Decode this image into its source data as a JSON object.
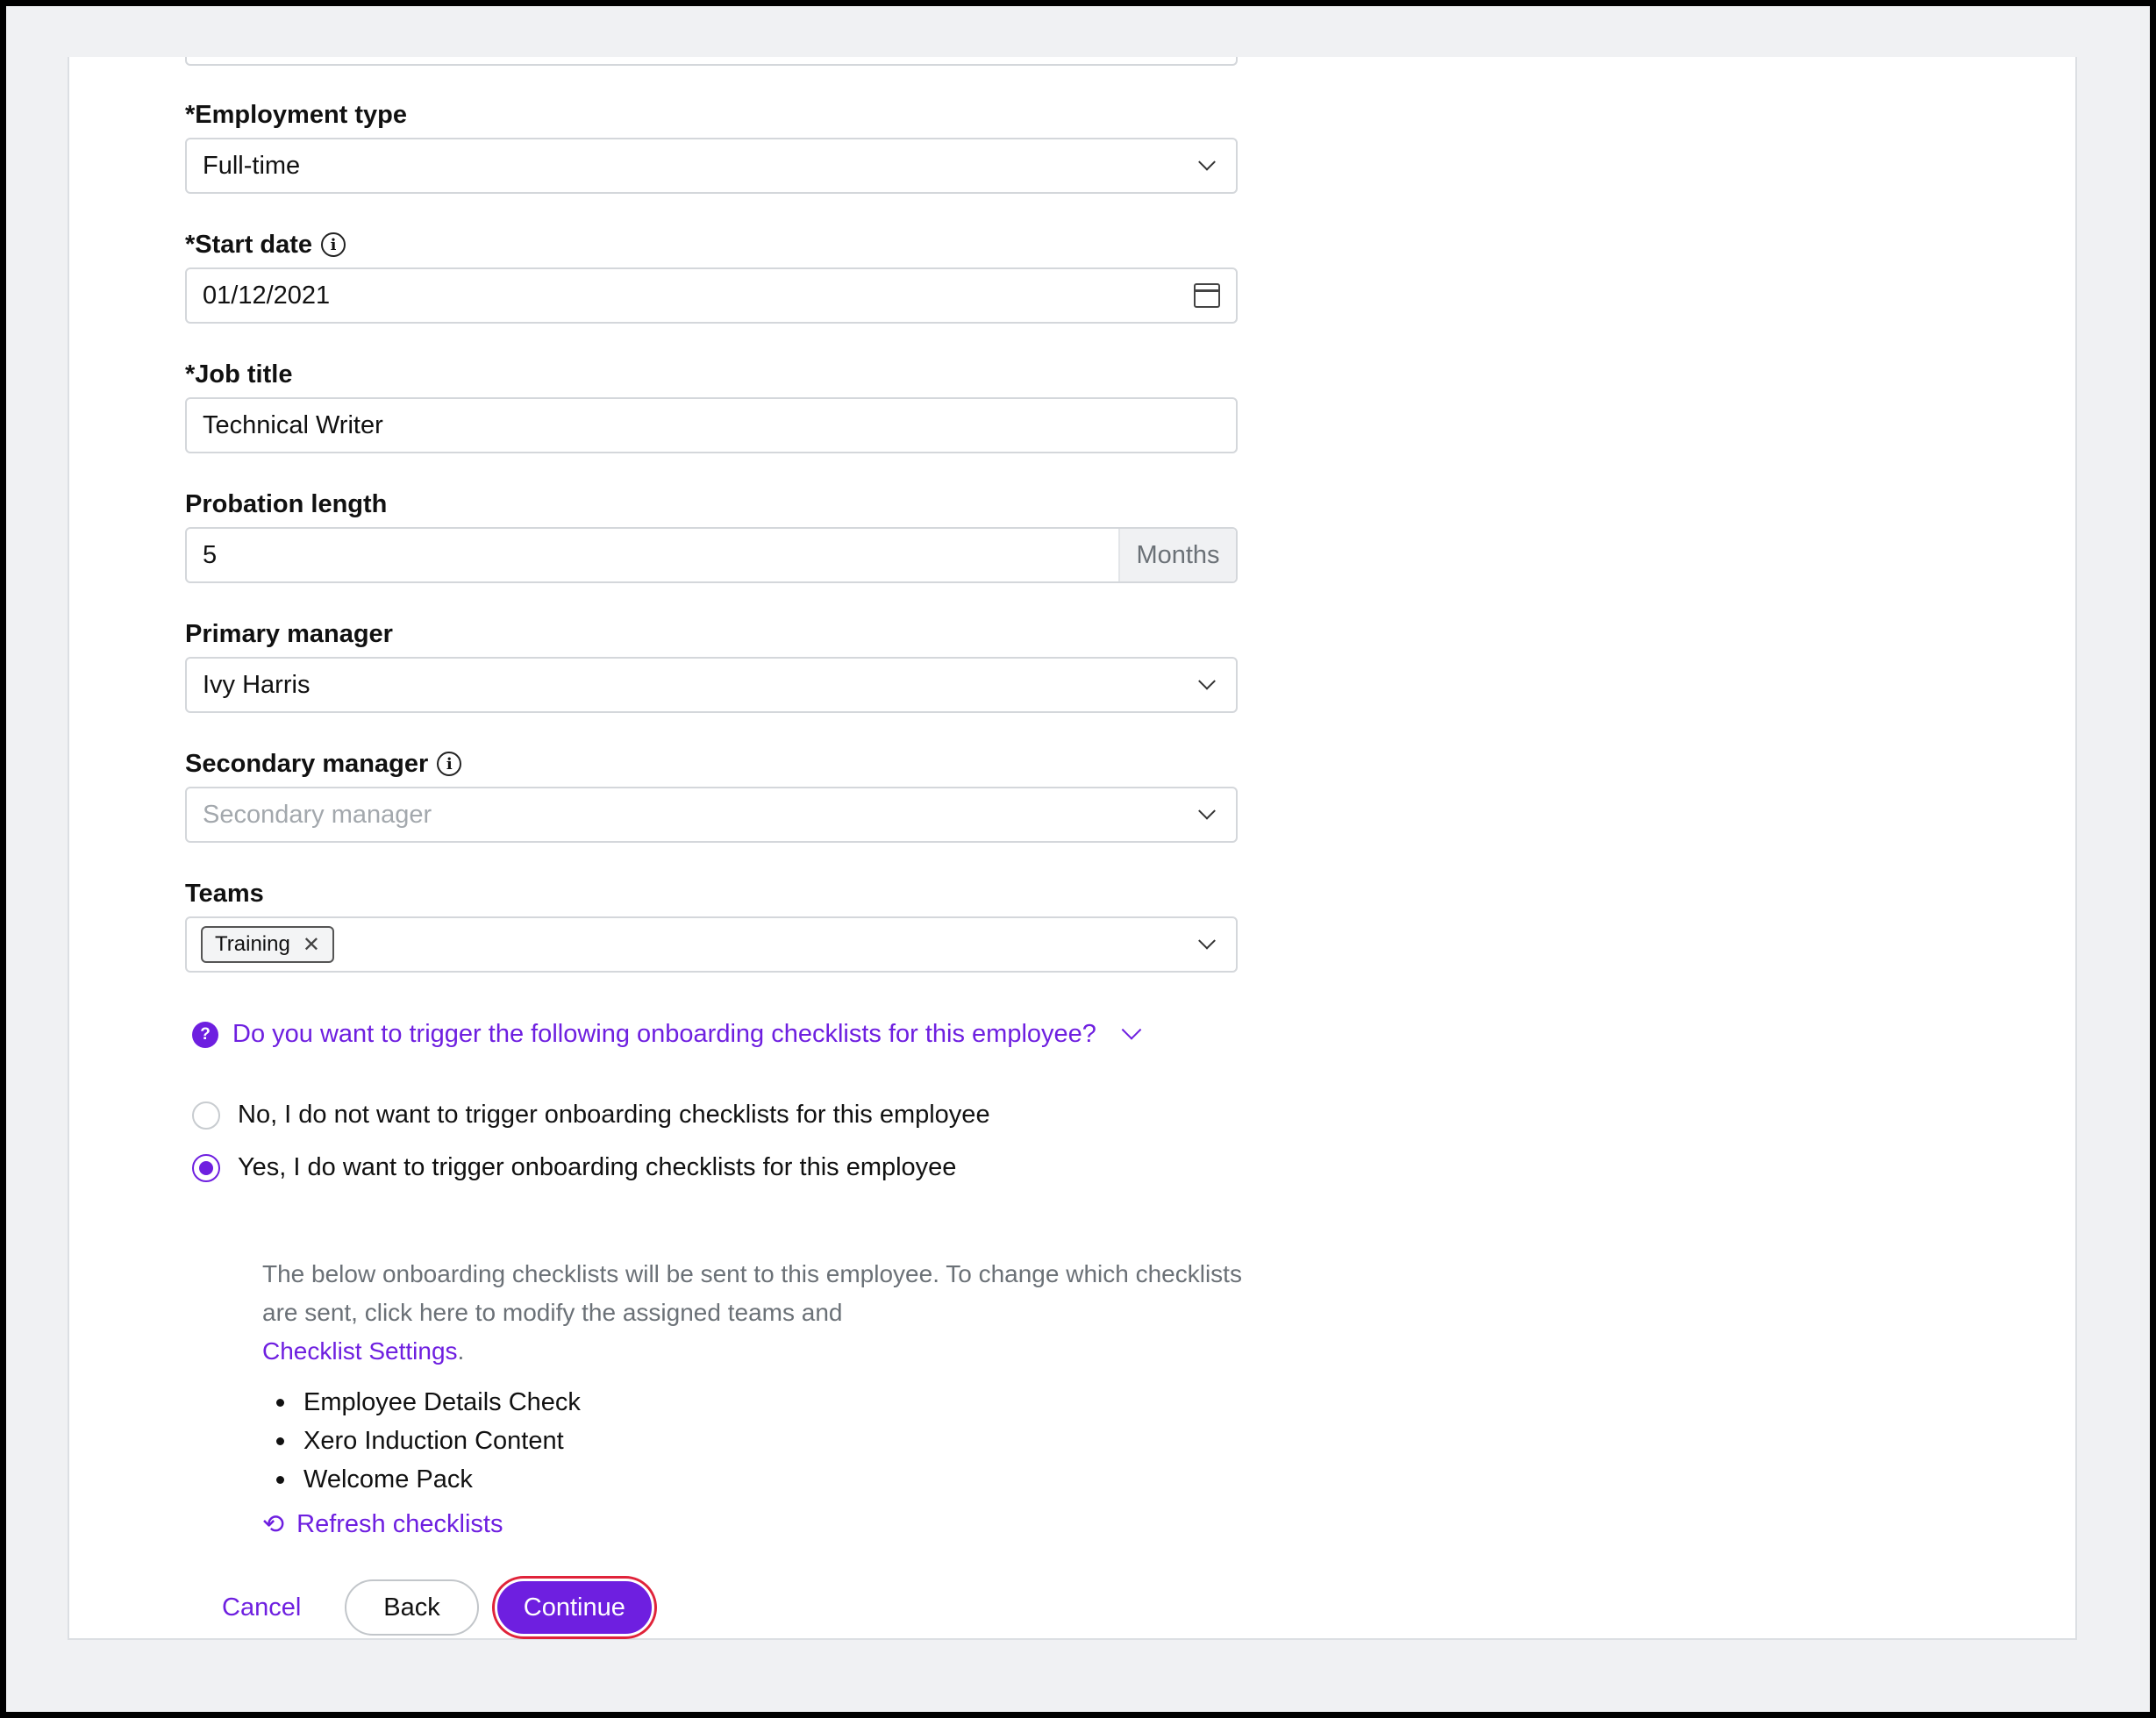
{
  "form": {
    "employment_type": {
      "label": "*Employment type",
      "value": "Full-time"
    },
    "start_date": {
      "label": "*Start date",
      "value": "01/12/2021"
    },
    "job_title": {
      "label": "*Job title",
      "value": "Technical Writer"
    },
    "probation": {
      "label": "Probation length",
      "value": "5",
      "unit": "Months"
    },
    "primary_manager": {
      "label": "Primary manager",
      "value": "Ivy Harris"
    },
    "secondary_manager": {
      "label": "Secondary manager",
      "placeholder": "Secondary manager"
    },
    "teams": {
      "label": "Teams",
      "tags": [
        "Training"
      ]
    }
  },
  "onboarding": {
    "question": "Do you want to trigger the following onboarding checklists for this employee?",
    "option_no": "No, I do not want to trigger onboarding checklists for this employee",
    "option_yes": "Yes, I do want to trigger onboarding checklists for this employee",
    "selected": "yes",
    "description": "The below onboarding checklists will be sent to this employee. To change which checklists are sent, click here to modify the assigned teams and",
    "settings_link": "Checklist Settings",
    "settings_suffix": ".",
    "checklists": [
      "Employee Details Check",
      "Xero Induction Content",
      "Welcome Pack"
    ],
    "refresh_label": "Refresh checklists"
  },
  "actions": {
    "cancel": "Cancel",
    "back": "Back",
    "continue": "Continue"
  },
  "colors": {
    "accent": "#6e1fe0",
    "focus_ring": "#e0233a"
  }
}
